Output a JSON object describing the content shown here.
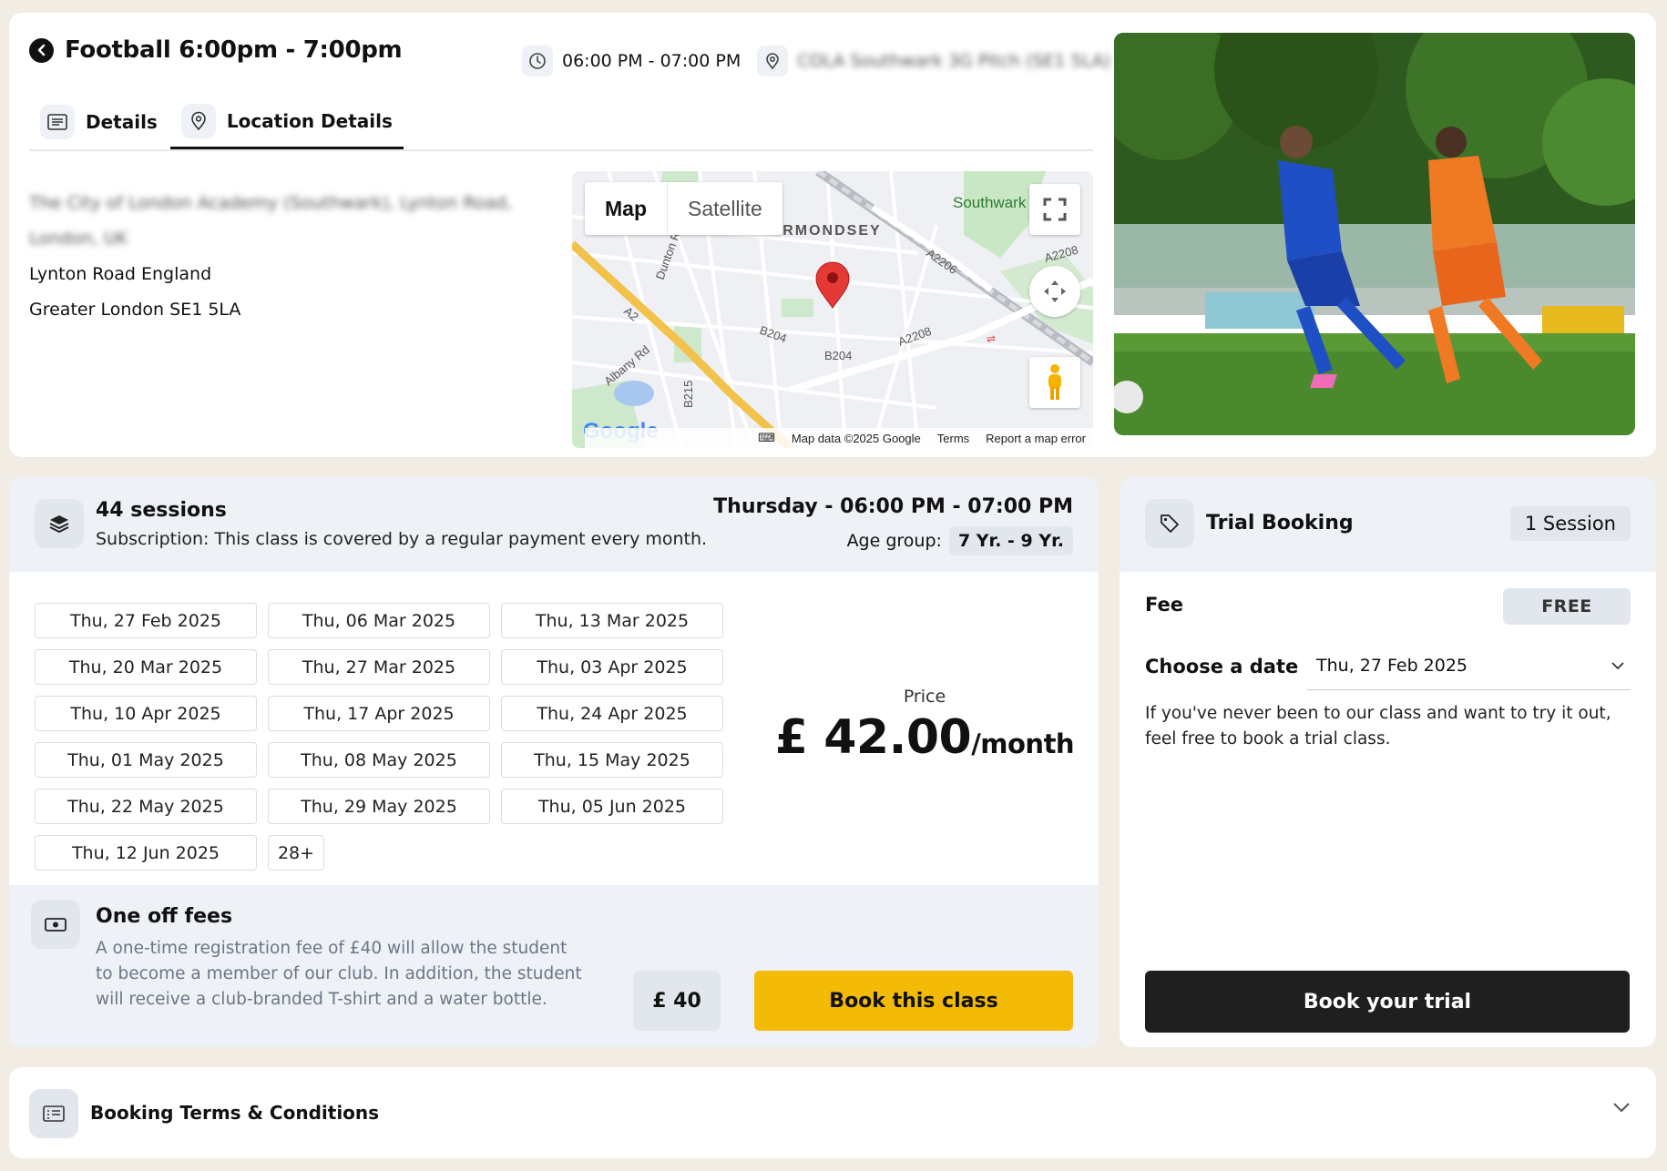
{
  "header": {
    "title": "Football 6:00pm - 7:00pm",
    "time": "06:00 PM - 07:00 PM",
    "venue_blurred": "COLA Southwark 3G Pitch (SE1 5LA)"
  },
  "tabs": [
    {
      "label": "Details",
      "icon": "document-icon"
    },
    {
      "label": "Location Details",
      "icon": "location-pin-icon"
    }
  ],
  "location": {
    "address_blurred": "The City of London Academy (Southwark), Lynton Road, London, UK",
    "line2": "Lynton Road England",
    "line3": "Greater London SE1 5LA"
  },
  "map": {
    "map_btn": "Map",
    "satellite_btn": "Satellite",
    "area_label": "BERMONDSEY",
    "park_label": "Southwark Park",
    "roads": [
      "A2",
      "A2206",
      "A2208",
      "B204",
      "B215",
      "Albany Rd",
      "Dunton Rd"
    ],
    "google": "Google",
    "attribution": "Map data ©2025 Google",
    "terms": "Terms",
    "report": "Report a map error"
  },
  "class_info": {
    "sessions": "44 sessions",
    "subscription": "Subscription: This class is covered by a regular payment every month.",
    "day_time": "Thursday - 06:00 PM - 07:00 PM",
    "age_label": "Age group:",
    "age_value": "7 Yr. - 9 Yr.",
    "dates": [
      "Thu, 27 Feb 2025",
      "Thu, 06 Mar 2025",
      "Thu, 13 Mar 2025",
      "Thu, 20 Mar 2025",
      "Thu, 27 Mar 2025",
      "Thu, 03 Apr 2025",
      "Thu, 10 Apr 2025",
      "Thu, 17 Apr 2025",
      "Thu, 24 Apr 2025",
      "Thu, 01 May 2025",
      "Thu, 08 May 2025",
      "Thu, 15 May 2025",
      "Thu, 22 May 2025",
      "Thu, 29 May 2025",
      "Thu, 05 Jun 2025",
      "Thu, 12 Jun 2025"
    ],
    "more_dates": "28+",
    "price_label": "Price",
    "price": "£ 42.00",
    "price_unit": "/month"
  },
  "fees": {
    "title": "One off fees",
    "description": "A one-time registration fee of £40 will allow the student to become a member of our club. In addition, the student will receive a club-branded T-shirt and a water bottle.",
    "amount": "£ 40",
    "book_button": "Book this class"
  },
  "trial": {
    "title": "Trial Booking",
    "session_badge": "1 Session",
    "fee_label": "Fee",
    "fee_value": "FREE",
    "date_label": "Choose a date",
    "date_value": "Thu, 27 Feb 2025",
    "note": "If you've never been to our class and want to try it out, feel free to book a trial class.",
    "book_button": "Book your trial"
  },
  "terms": {
    "title": "Booking Terms & Conditions"
  },
  "colors": {
    "accent": "#f4bb06",
    "dark_button": "#1f1f1f",
    "page_bg": "#f1ece4",
    "panel_bg": "#eef1f6"
  }
}
